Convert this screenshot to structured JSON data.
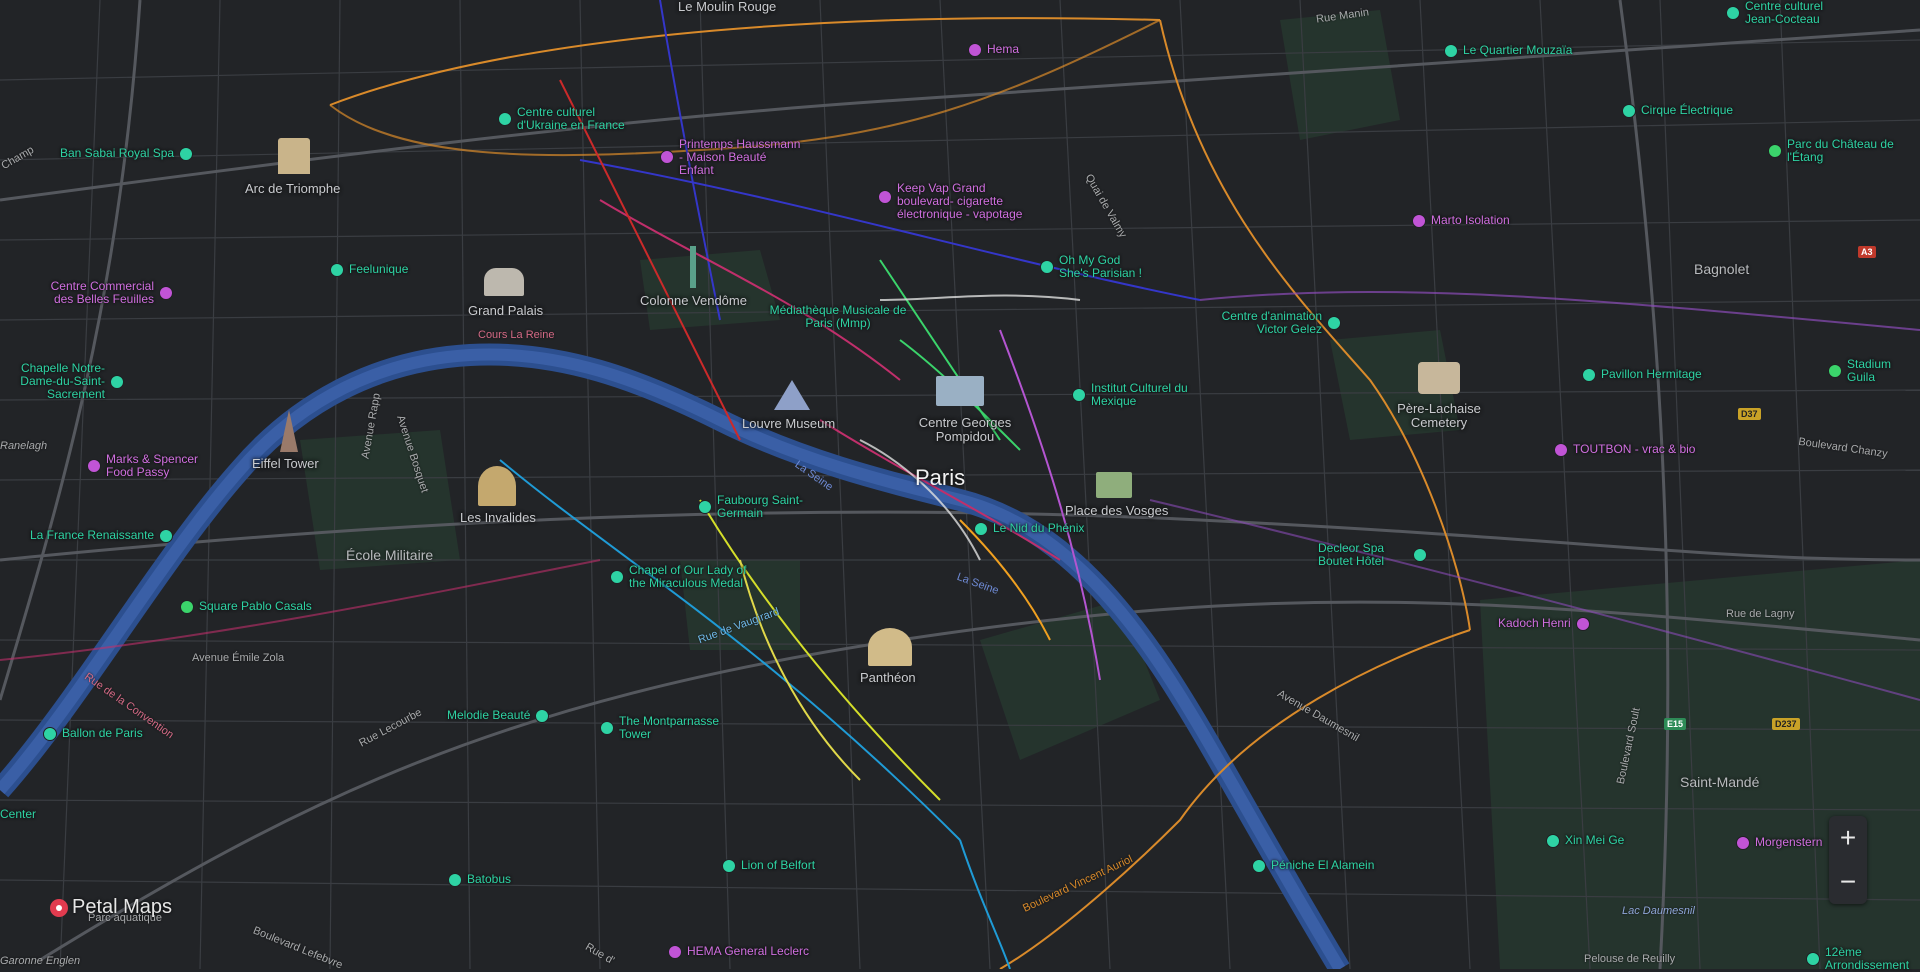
{
  "map": {
    "city": "Paris",
    "colors": {
      "background": "#222427",
      "water": "#2c4f8f",
      "poi_green": "#2ed3a4",
      "poi_purple": "#c154d6",
      "label": "#c9cbcf",
      "accent_orange": "#d98a2a"
    }
  },
  "districts": [
    {
      "name": "Bagnolet"
    },
    {
      "name": "Saint-Mandé"
    },
    {
      "name": "École Militaire"
    }
  ],
  "places": [
    {
      "name": "Le Moulin Rouge"
    },
    {
      "name": "Arc de Triomphe"
    },
    {
      "name": "Grand Palais"
    },
    {
      "name": "Colonne Vendôme"
    },
    {
      "name": "Eiffel Tower"
    },
    {
      "name": "Les Invalides"
    },
    {
      "name": "Louvre Museum"
    },
    {
      "name": "Centre Georges Pompidou"
    },
    {
      "name": "Place des Vosges"
    },
    {
      "name": "Panthéon"
    },
    {
      "name": "Père-Lachaise Cemetery"
    },
    {
      "name": "Cours La Reine"
    }
  ],
  "pois_green": [
    {
      "name": "Centre culturel d'Ukraine en France"
    },
    {
      "name": "Ban Sabai Royal Spa"
    },
    {
      "name": "Feelunique"
    },
    {
      "name": "Médiathèque Musicale de Paris (Mmp)"
    },
    {
      "name": "Oh My God She's Parisian !"
    },
    {
      "name": "Le Quartier Mouzaïa"
    },
    {
      "name": "Cirque Électrique"
    },
    {
      "name": "Parc du Château de l'Étang"
    },
    {
      "name": "Centre d'animation Victor Gelez"
    },
    {
      "name": "Pavillon Hermitage"
    },
    {
      "name": "Stadium Guila"
    },
    {
      "name": "Chapelle Notre-Dame-du-Saint-Sacrement"
    },
    {
      "name": "Institut Culturel du Mexique"
    },
    {
      "name": "Faubourg Saint-Germain"
    },
    {
      "name": "Le Nid du Phénix"
    },
    {
      "name": "La France Renaissante"
    },
    {
      "name": "Chapel of Our Lady of the Miraculous Medal"
    },
    {
      "name": "Square Pablo Casals"
    },
    {
      "name": "Decleor Spa Boutet Hôtel"
    },
    {
      "name": "Melodie Beauté"
    },
    {
      "name": "The Montparnasse Tower"
    },
    {
      "name": "Ballon de Paris"
    },
    {
      "name": "Batobus"
    },
    {
      "name": "Lion of Belfort"
    },
    {
      "name": "Péniche El Alamein"
    },
    {
      "name": "Xin Mei Ge"
    },
    {
      "name": "Centre culturel Jean-Cocteau"
    },
    {
      "name": "Center"
    },
    {
      "name": "12ème Arrondissement"
    }
  ],
  "pois_purple": [
    {
      "name": "Hema"
    },
    {
      "name": "Printemps Haussmann - Maison Beauté Enfant"
    },
    {
      "name": "Keep Vap Grand boulevard- cigarette électronique - vapotage"
    },
    {
      "name": "Marto Isolation"
    },
    {
      "name": "Centre Commercial des Belles Feuilles"
    },
    {
      "name": "Marks & Spencer Food Passy"
    },
    {
      "name": "TOUTBON - vrac & bio"
    },
    {
      "name": "Kadoch Henri"
    },
    {
      "name": "Morgenstern"
    },
    {
      "name": "HEMA General Leclerc"
    }
  ],
  "streets": [
    {
      "name": "Rue Manin"
    },
    {
      "name": "Quai de Valmy"
    },
    {
      "name": "Avenue Rapp"
    },
    {
      "name": "Avenue Bosquet"
    },
    {
      "name": "Avenue Émile Zola"
    },
    {
      "name": "Rue de la Convention"
    },
    {
      "name": "Rue Lecourbe"
    },
    {
      "name": "Rue de Vaugirard"
    },
    {
      "name": "Boulevard Chanzy"
    },
    {
      "name": "Rue de Lagny"
    },
    {
      "name": "Avenue Daumesnil"
    },
    {
      "name": "Boulevard Soult"
    },
    {
      "name": "Boulevard Vincent Auriol"
    },
    {
      "name": "Boulevard Lefebvre"
    },
    {
      "name": "Rue d'"
    },
    {
      "name": "Pelouse de Reuilly"
    },
    {
      "name": "Lac Daumesnil"
    },
    {
      "name": "Ranelagh"
    },
    {
      "name": "Champ"
    },
    {
      "name": "Parc aquatique"
    },
    {
      "name": "Garonne Englen"
    }
  ],
  "water_labels": [
    {
      "name": "La Seine"
    },
    {
      "name": "La Seine"
    }
  ],
  "road_badges": [
    {
      "name": "A3",
      "color": "#c0392b"
    },
    {
      "name": "D37",
      "color": "#c9a227"
    },
    {
      "name": "E15",
      "color": "#2e8b57"
    },
    {
      "name": "D237",
      "color": "#c9a227"
    }
  ],
  "zoom": {
    "in": "+",
    "out": "−"
  },
  "brand": {
    "name": "Petal Maps"
  }
}
